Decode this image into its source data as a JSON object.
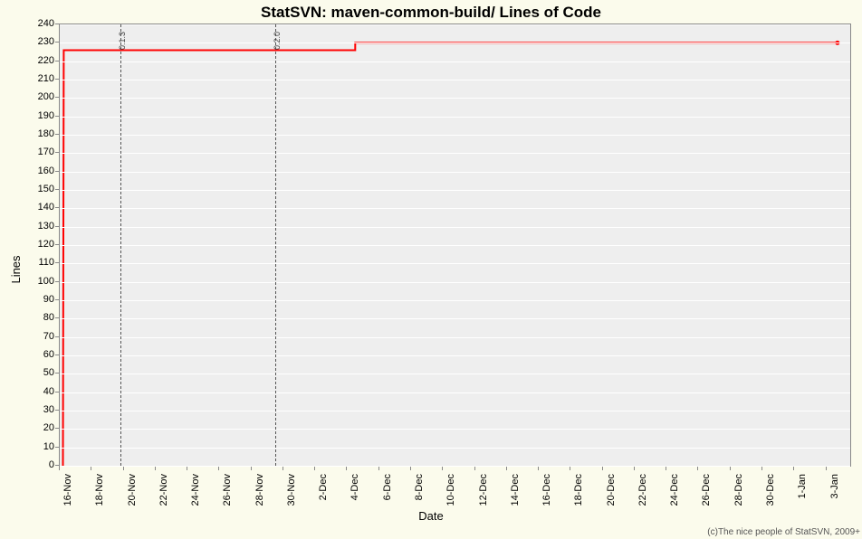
{
  "chart_data": {
    "type": "line",
    "title": "StatSVN: maven-common-build/ Lines of Code",
    "xlabel": "Date",
    "ylabel": "Lines",
    "ylim": [
      0,
      240
    ],
    "y_ticks": [
      0,
      10,
      20,
      30,
      40,
      50,
      60,
      70,
      80,
      90,
      100,
      110,
      120,
      130,
      140,
      150,
      160,
      170,
      180,
      190,
      200,
      210,
      220,
      230,
      240
    ],
    "x_categories": [
      "16-Nov",
      "18-Nov",
      "20-Nov",
      "22-Nov",
      "24-Nov",
      "26-Nov",
      "28-Nov",
      "30-Nov",
      "2-Dec",
      "4-Dec",
      "6-Dec",
      "8-Dec",
      "10-Dec",
      "12-Dec",
      "14-Dec",
      "16-Dec",
      "18-Dec",
      "20-Dec",
      "22-Dec",
      "24-Dec",
      "26-Dec",
      "28-Dec",
      "30-Dec",
      "1-Jan",
      "3-Jan"
    ],
    "x_range_days": 49.5,
    "series": [
      {
        "name": "Lines of Code",
        "color": "#ff0000",
        "points": [
          {
            "x_day": 0.2,
            "y": 0
          },
          {
            "x_day": 0.25,
            "y": 226
          },
          {
            "x_day": 18.5,
            "y": 226
          },
          {
            "x_day": 18.5,
            "y": 230
          },
          {
            "x_day": 48.7,
            "y": 230
          }
        ],
        "last_point_marker": true
      }
    ],
    "markers": [
      {
        "x_day": 3.8,
        "label": "0.1.3"
      },
      {
        "x_day": 13.5,
        "label": "0.2.0"
      }
    ]
  },
  "copyright": "(c)The nice people of StatSVN, 2009+"
}
